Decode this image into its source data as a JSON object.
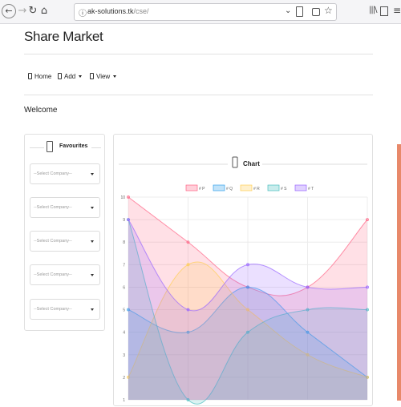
{
  "browser": {
    "url_host": "ak-solutions.tk",
    "url_path": "/cse/",
    "icons": [
      "back-icon",
      "forward-icon",
      "reload-icon",
      "home-icon",
      "info-icon",
      "dropdown-icon",
      "reader-icon",
      "pocket-icon",
      "star-icon",
      "library-icon",
      "sidebar-icon",
      "menu-icon"
    ]
  },
  "page": {
    "title": "Share Market",
    "welcome": "Welcome"
  },
  "nav": {
    "home": "Home",
    "add": "Add",
    "view": "View"
  },
  "favourites": {
    "title": "Favourites",
    "selects": [
      {
        "placeholder": "--Select Company--"
      },
      {
        "placeholder": "--Select Company--"
      },
      {
        "placeholder": "--Select Company--"
      },
      {
        "placeholder": "--Select Company--"
      },
      {
        "placeholder": "--Select Company--"
      }
    ]
  },
  "chart_data": {
    "type": "area",
    "title": "Chart",
    "xlabel": "",
    "ylabel": "",
    "x": [
      0,
      1,
      2,
      3,
      4
    ],
    "ylim": [
      1,
      10
    ],
    "yticks": [
      "1",
      "2",
      "3",
      "4",
      "5",
      "6",
      "7",
      "8",
      "9",
      "10"
    ],
    "grid": true,
    "legend_position": "top",
    "series": [
      {
        "name": "# P",
        "color": "#ff6384",
        "values": [
          10,
          8,
          6,
          6,
          9
        ]
      },
      {
        "name": "# Q",
        "color": "#36a2eb",
        "values": [
          5,
          4,
          6,
          4,
          2
        ]
      },
      {
        "name": "# R",
        "color": "#ffce56",
        "values": [
          2,
          7,
          5,
          3,
          2
        ]
      },
      {
        "name": "# S",
        "color": "#4bc0c0",
        "values": [
          9,
          1,
          4,
          5,
          5
        ]
      },
      {
        "name": "# T",
        "color": "#9966ff",
        "values": [
          9,
          5,
          7,
          6,
          6
        ]
      }
    ]
  }
}
